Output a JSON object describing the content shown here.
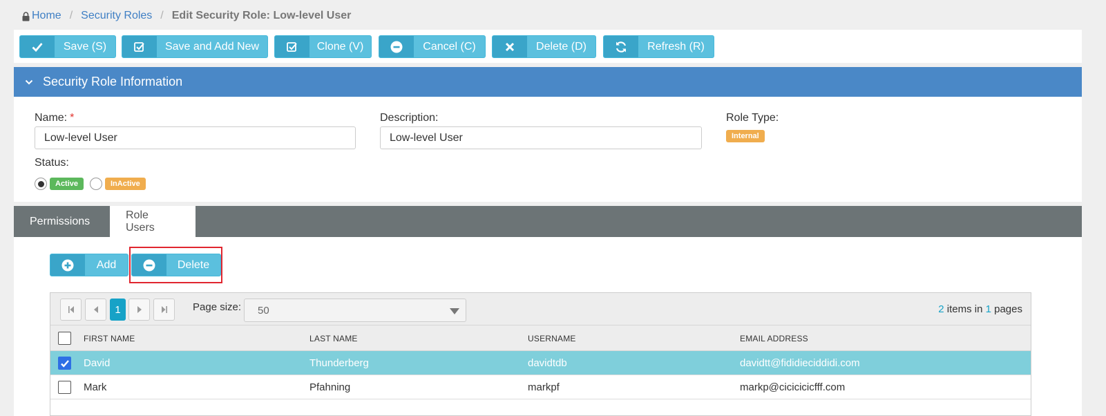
{
  "breadcrumb": {
    "home": "Home",
    "security_roles": "Security Roles",
    "current": "Edit Security Role: Low-level User"
  },
  "toolbar": {
    "save": "Save (S)",
    "save_add_new": "Save and Add New",
    "clone": "Clone (V)",
    "cancel": "Cancel (C)",
    "delete": "Delete (D)",
    "refresh": "Refresh (R)"
  },
  "panel": {
    "title": "Security Role Information",
    "name_label": "Name:",
    "required_mark": "*",
    "name_value": "Low-level User",
    "description_label": "Description:",
    "description_value": "Low-level User",
    "role_type_label": "Role Type:",
    "role_type_badge": "Internal",
    "status_label": "Status:",
    "status_active": "Active",
    "status_inactive": "InActive",
    "status_selected": "Active"
  },
  "tabs": [
    "Permissions",
    "Role Users"
  ],
  "active_tab": "Role Users",
  "actions": {
    "add": "Add",
    "delete": "Delete"
  },
  "pager": {
    "current_page": "1",
    "page_size_label": "Page size:",
    "page_size_value": "50",
    "items_count": "2",
    "items_text": " items in ",
    "pages_count": "1",
    "pages_text": " pages"
  },
  "grid": {
    "columns": [
      "FIRST NAME",
      "LAST NAME",
      "USERNAME",
      "EMAIL ADDRESS"
    ],
    "rows": [
      {
        "first": "David",
        "last": "Thunderberg",
        "username": "davidtdb",
        "email": "davidtt@fididieciddidi.com",
        "selected": true
      },
      {
        "first": "Mark",
        "last": "Pfahning",
        "username": "markpf",
        "email": "markp@cicicicicfff.com",
        "selected": false
      }
    ]
  },
  "colors": {
    "accent_blue": "#4a88c7",
    "button_cyan": "#5bc0de",
    "active_green": "#5cb85c",
    "warning_orange": "#f0ad4e",
    "highlight_red": "#e0262f",
    "selected_row": "#7fcfdb"
  }
}
